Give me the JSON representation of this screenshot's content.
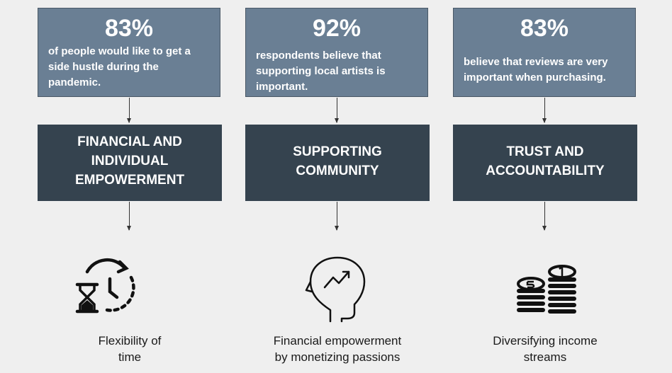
{
  "columns": [
    {
      "stat_value": "83%",
      "stat_description": " of people would like to get a\nside hustle during the\npandemic.",
      "theme": "FINANCIAL AND\nINDIVIDUAL\nEMPOWERMENT",
      "icon": "time-flexibility-icon",
      "caption": "Flexibility of\ntime"
    },
    {
      "stat_value": "92%",
      "stat_description": "respondents believe that\nsupporting local artists is\nimportant.",
      "theme": "SUPPORTING\nCOMMUNITY",
      "icon": "head-growth-icon",
      "caption": "Financial empowerment\nby monetizing passions"
    },
    {
      "stat_value": "83%",
      "stat_description": "believe that reviews are very\nimportant when purchasing.",
      "theme": "TRUST AND\nACCOUNTABILITY",
      "icon": "coin-stacks-icon",
      "caption": "Diversifying income\nstreams"
    }
  ],
  "colors": {
    "background": "#efefef",
    "stat_box": "#6a7f94",
    "theme_box": "#35434f",
    "text_light": "#ffffff",
    "icon": "#111111"
  }
}
